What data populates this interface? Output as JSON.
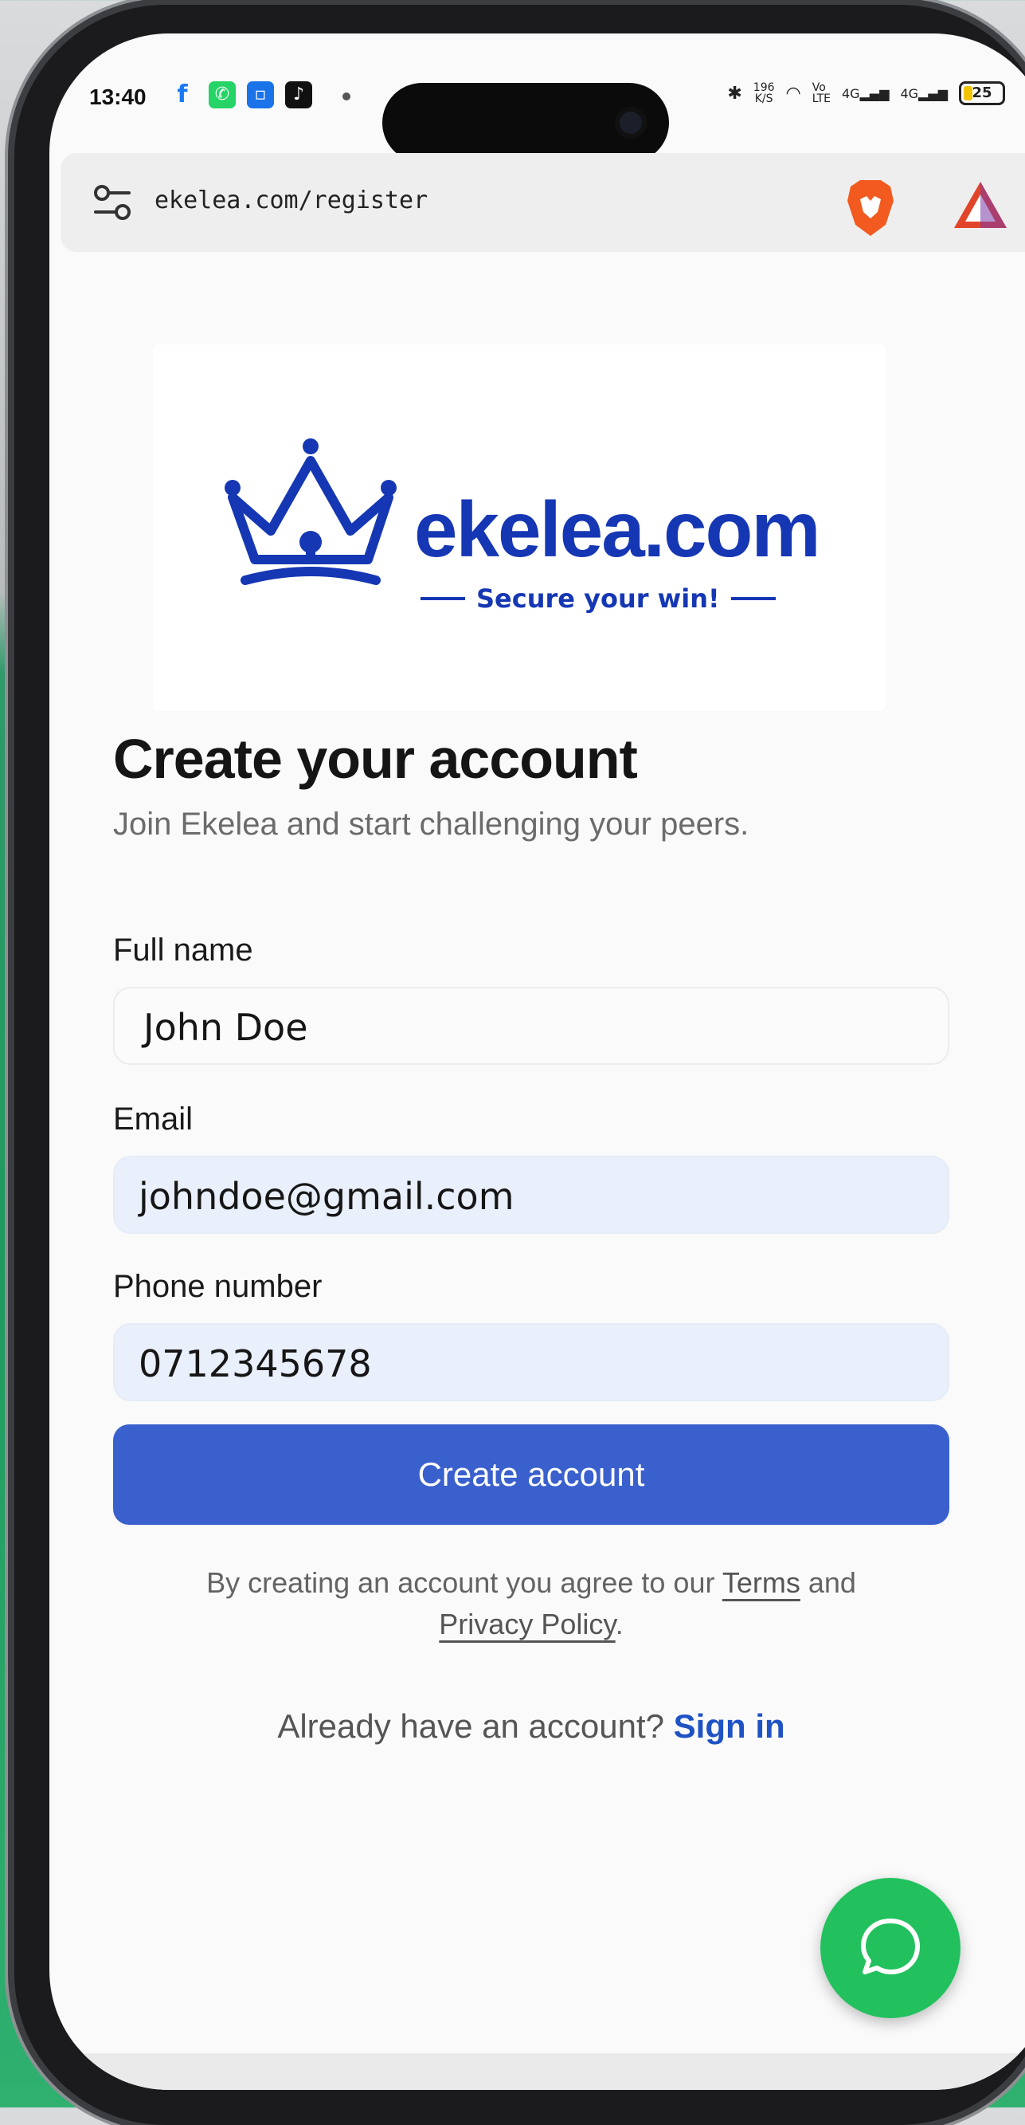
{
  "status_bar": {
    "time": "13:40",
    "speed": "196\nK/S",
    "signal_labels": [
      "Vo\nLTE",
      "4G",
      "4G"
    ],
    "battery": "25",
    "battery_level": 0.25
  },
  "browser": {
    "url": "ekelea.com/register"
  },
  "logo": {
    "brand": "ekelea.com",
    "tagline": "Secure your win!",
    "color": "#1637b4"
  },
  "form": {
    "title": "Create your account",
    "subtitle": "Join Ekelea and start challenging your peers.",
    "full_name_label": "Full name",
    "full_name_value": "John Doe",
    "email_label": "Email",
    "email_value": "johndoe@gmail.com",
    "phone_label": "Phone number",
    "phone_value": "0712345678",
    "submit_label": "Create account",
    "terms_prefix": "By creating an account you agree to our",
    "terms_link": "Terms",
    "terms_and": "and",
    "privacy_link": "Privacy Policy",
    "terms_suffix": ".",
    "signin_prompt": "Already have an account?",
    "signin_link": "Sign in"
  },
  "colors": {
    "primary": "#3a60cd",
    "link": "#1f52c4",
    "chat_fab": "#22c15e"
  }
}
